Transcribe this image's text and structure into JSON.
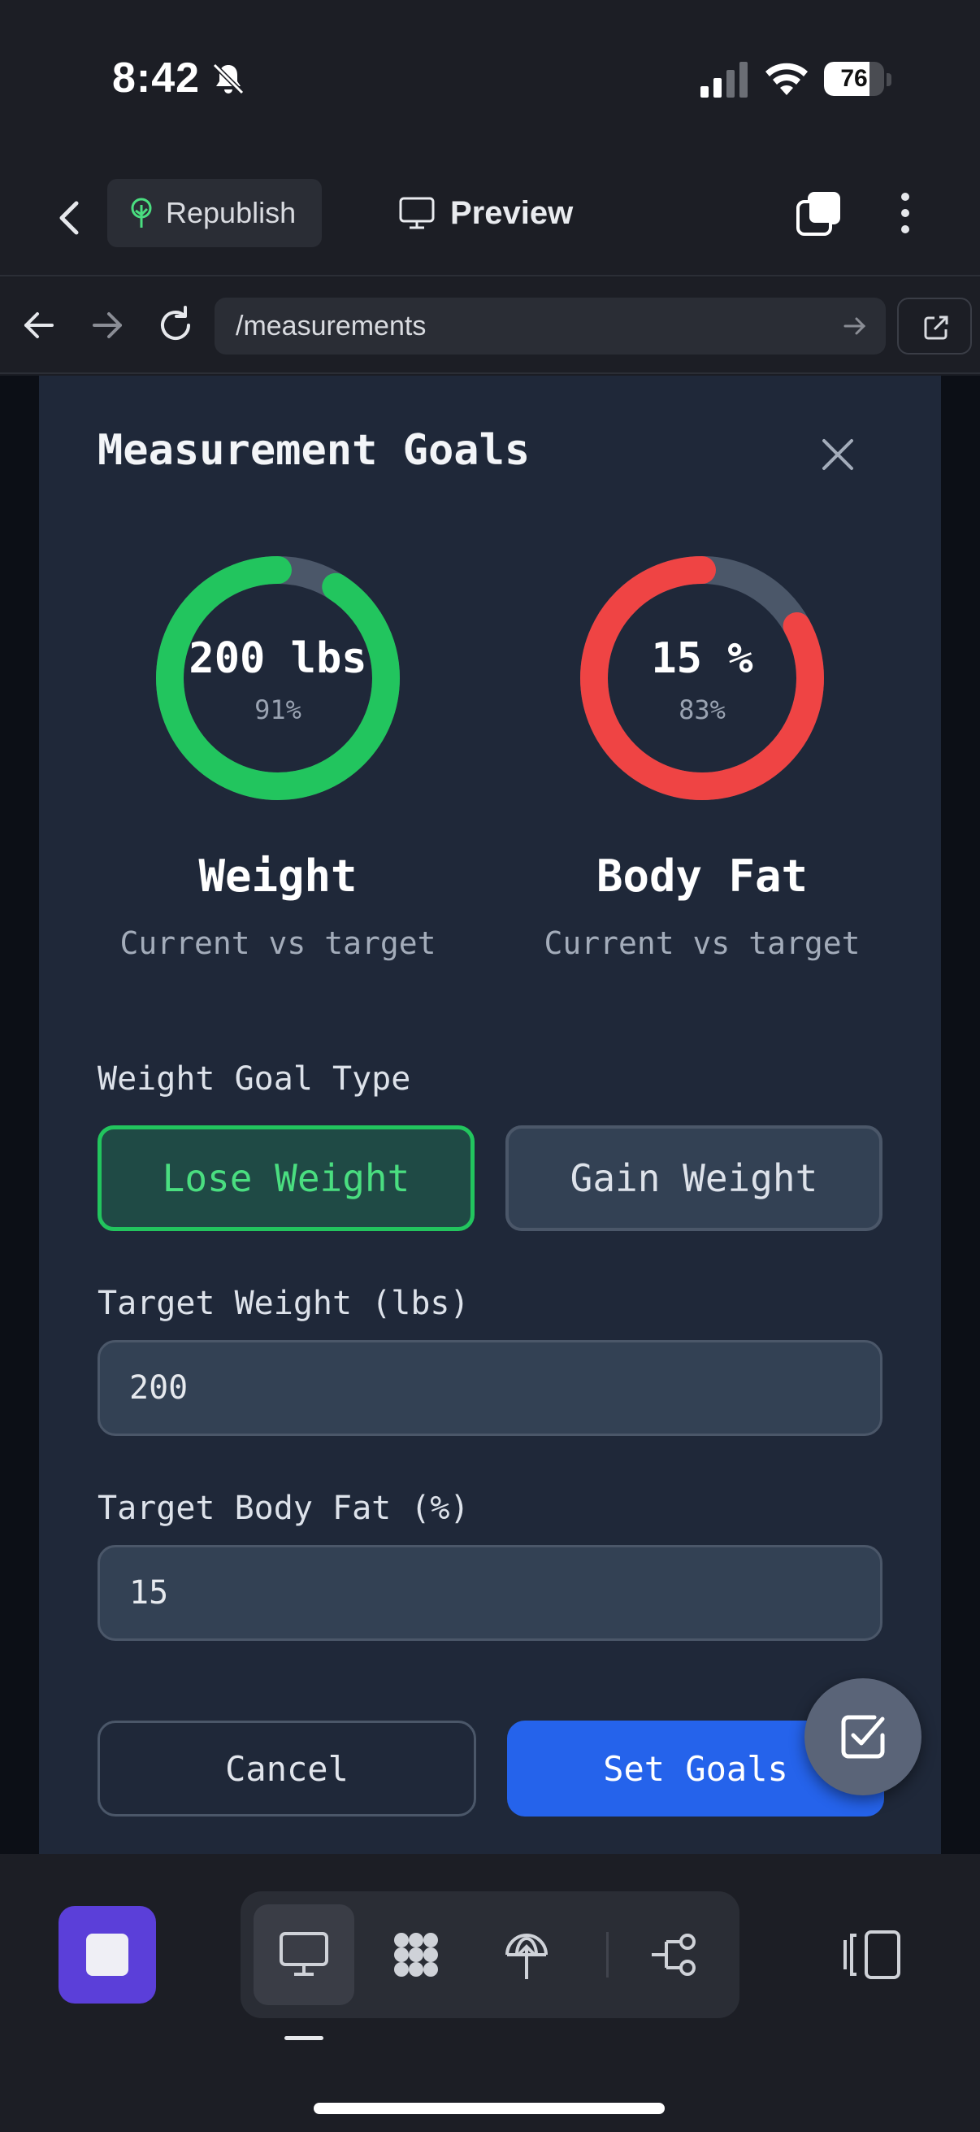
{
  "status_bar": {
    "time": "8:42",
    "battery": "76",
    "battery_level": 0.76
  },
  "header": {
    "republish_label": "Republish",
    "preview_label": "Preview"
  },
  "browser": {
    "url": "/measurements"
  },
  "modal": {
    "title": "Measurement Goals",
    "metrics": [
      {
        "value": "200 lbs",
        "percent": "91%",
        "progress": 0.91,
        "label": "Weight",
        "sub": "Current vs target",
        "color": "#22c55e"
      },
      {
        "value": "15 %",
        "percent": "83%",
        "progress": 0.83,
        "label": "Body Fat",
        "sub": "Current vs target",
        "color": "#ef4444"
      }
    ],
    "goal_type_label": "Weight Goal Type",
    "goal_options": [
      "Lose Weight",
      "Gain Weight"
    ],
    "selected_goal": "Lose Weight",
    "target_weight_label": "Target Weight (lbs)",
    "target_weight_value": "200",
    "target_bodyfat_label": "Target Body Fat (%)",
    "target_bodyfat_value": "15",
    "cancel_label": "Cancel",
    "submit_label": "Set Goals"
  },
  "colors": {
    "accent_blue": "#2563eb",
    "success_green": "#22c55e",
    "danger_red": "#ef4444",
    "purple": "#5b3fd9",
    "track_gray": "#4b5769"
  },
  "icons": [
    "bell-slash-icon",
    "signal-icon",
    "wifi-icon",
    "battery-icon",
    "chevron-left-icon",
    "tree-icon",
    "monitor-icon",
    "tabs-icon",
    "more-vertical-icon",
    "arrow-left-icon",
    "arrow-right-icon",
    "reload-icon",
    "external-link-icon",
    "close-icon",
    "checkbox-edit-icon",
    "stop-icon",
    "dots-grid-icon",
    "antenna-icon",
    "share-nodes-icon",
    "panel-icon"
  ]
}
